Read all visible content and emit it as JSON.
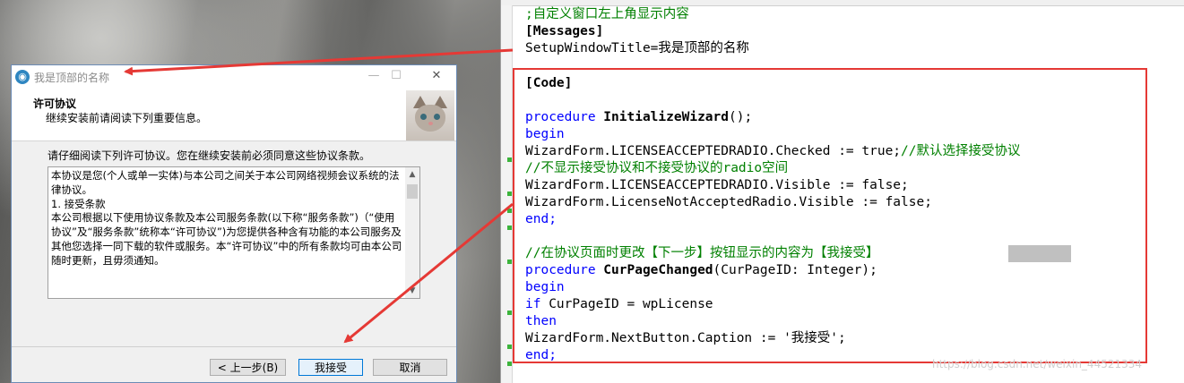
{
  "dialog": {
    "title": "我是顶部的名称",
    "header_title": "许可协议",
    "header_subtitle": "继续安装前请阅读下列重要信息。",
    "intro": "请仔细阅读下列许可协议。您在继续安装前必须同意这些协议条款。",
    "license_paragraphs": [
      "本协议是您(个人或单一实体)与本公司之间关于本公司网络视频会议系统的法律协议。",
      " ",
      "1. 接受条款",
      "本公司根据以下使用协议条款及本公司服务条款(以下称“服务条款”)（“使用协议”及“服务条款”统称本“许可协议”)为您提供各种含有功能的本公司服务及其他您选择一同下载的软件或服务。本“许可协议”中的所有条款均可由本公司随时更新，且毋须通知。"
    ],
    "buttons": {
      "back": "< 上一步(B)",
      "next": "我接受",
      "cancel": "取消"
    },
    "window_controls": {
      "minimize": "—",
      "maximize": "☐",
      "close": "✕"
    }
  },
  "editor": {
    "lines": {
      "l1": ";自定义窗口左上角显示内容",
      "l2": "[Messages]",
      "l3": "SetupWindowTitle=我是顶部的名称",
      "l4": "[Code]",
      "l5_kw": "procedure",
      "l5_name": " InitializeWizard",
      "l5_rest": "();",
      "l6": "begin",
      "l7_code": "WizardForm.LICENSEACCEPTEDRADIO.Checked := true;",
      "l7_comment": "//默认选择接受协议",
      "l8": "//不显示接受协议和不接受协议的radio空间",
      "l9": "WizardForm.LICENSEACCEPTEDRADIO.Visible := false;",
      "l10": "WizardForm.LicenseNotAcceptedRadio.Visible := false;",
      "l11": "end;",
      "l12": "//在协议页面时更改【下一步】按钮显示的内容为【我接受】",
      "l13_kw": "procedure",
      "l13_name": " CurPageChanged",
      "l13_rest": "(CurPageID: Integer);",
      "l14": "begin",
      "l15_kw": "if",
      "l15_rest": " CurPageID = wpLicense",
      "l16": "then",
      "l17": "WizardForm.NextButton.Caption := '我接受';",
      "l18": "end;"
    },
    "watermark": "https://blog.csdn.net/weixin_44521334"
  },
  "colors": {
    "annotation": "#e53935",
    "keyword": "#0000ff",
    "comment": "#008000"
  }
}
